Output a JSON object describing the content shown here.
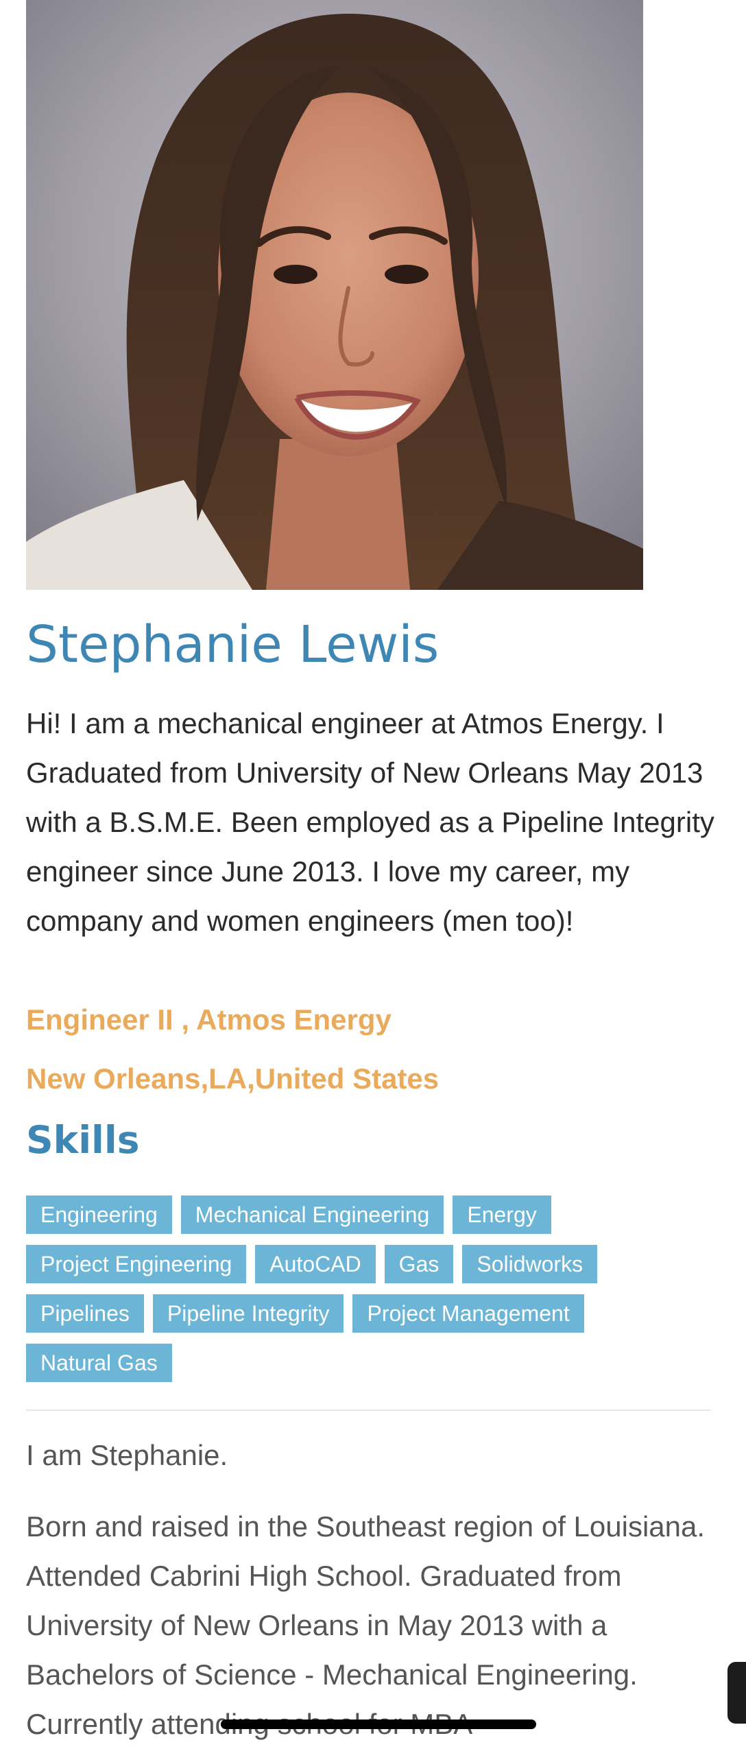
{
  "profile": {
    "photo_alt": "profile-photo",
    "name": "Stephanie Lewis",
    "bio": "Hi! I am a mechanical engineer at Atmos Energy. I Graduated from University of New Orleans May 2013 with a B.S.M.E. Been employed as a Pipeline Integrity engineer since June 2013. I love my career, my company and women engineers (men too)!",
    "job": "Engineer II , Atmos Energy",
    "location": "New Orleans,LA,United States"
  },
  "skills": {
    "heading": "Skills",
    "tags": [
      "Engineering",
      "Mechanical Engineering",
      "Energy",
      "Project Engineering",
      "AutoCAD",
      "Gas",
      "Solidworks",
      "Pipelines",
      "Pipeline Integrity",
      "Project Management",
      "Natural Gas"
    ]
  },
  "about": {
    "intro": "I am Stephanie.",
    "story": "Born and raised in the Southeast region of Louisiana. Attended Cabrini High School. Graduated from University of New Orleans in May 2013 with a Bachelors of Science - Mechanical Engineering. Currently attending school for MBA"
  },
  "colors": {
    "name": "#3e86b4",
    "accent": "#e9aa5b",
    "tag_bg": "#6db5d6",
    "tag_text": "#ffffff"
  }
}
